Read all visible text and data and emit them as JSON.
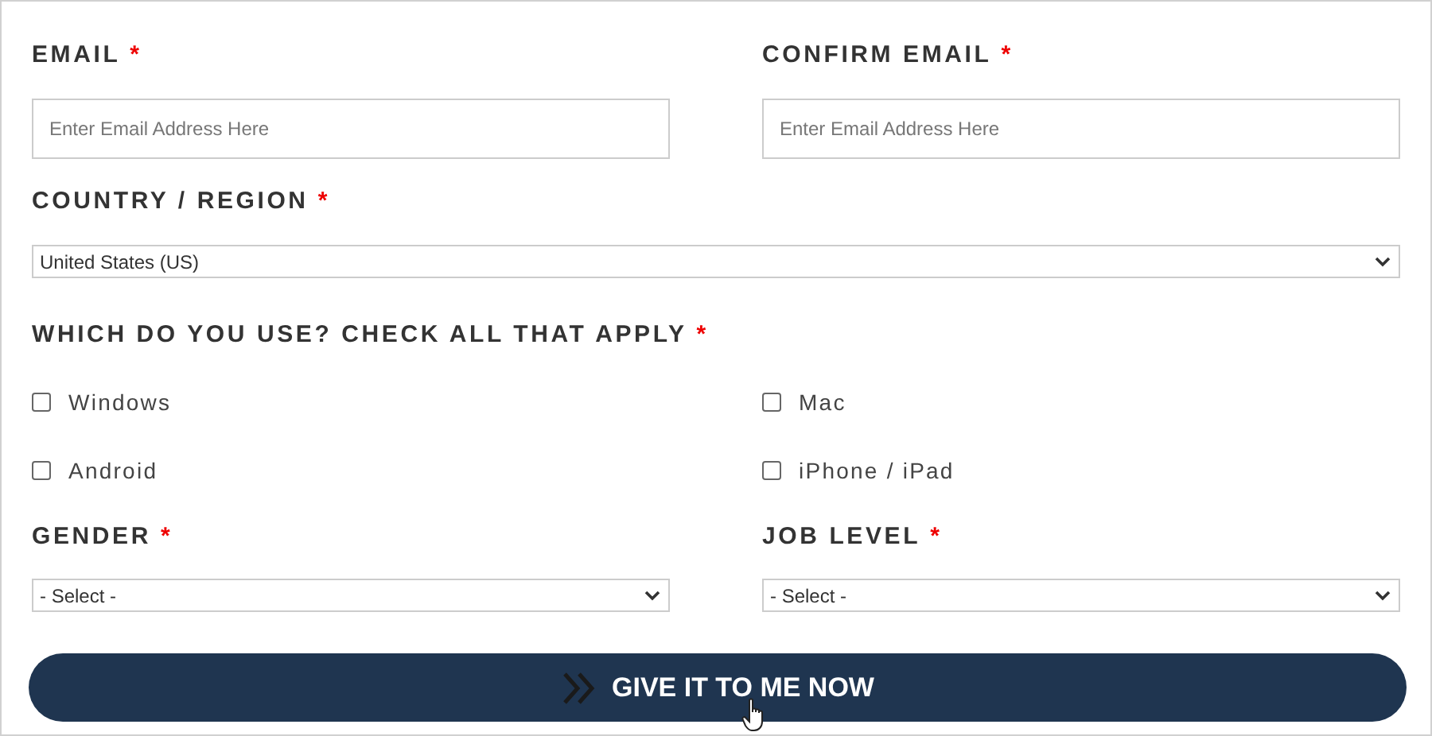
{
  "email": {
    "label": "EMAIL",
    "required_mark": "*",
    "placeholder": "Enter Email Address Here"
  },
  "confirm_email": {
    "label": "CONFIRM EMAIL",
    "required_mark": "*",
    "placeholder": "Enter Email Address Here"
  },
  "country": {
    "label": "COUNTRY / REGION",
    "required_mark": "*",
    "value": "United States (US)"
  },
  "platforms": {
    "label": "WHICH DO YOU USE? CHECK ALL THAT APPLY",
    "required_mark": "*",
    "options": [
      {
        "label": "Windows",
        "checked": false
      },
      {
        "label": "Mac",
        "checked": false
      },
      {
        "label": "Android",
        "checked": false
      },
      {
        "label": "iPhone / iPad",
        "checked": false
      }
    ]
  },
  "gender": {
    "label": "GENDER",
    "required_mark": "*",
    "value": "- Select -"
  },
  "job_level": {
    "label": "JOB LEVEL",
    "required_mark": "*",
    "value": "- Select -"
  },
  "submit": {
    "label": "GIVE IT TO ME NOW"
  }
}
